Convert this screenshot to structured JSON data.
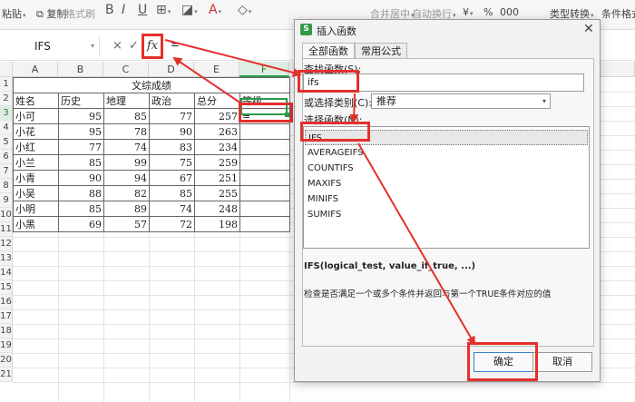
{
  "ribbon": {
    "items": [
      {
        "label": "粘贴",
        "dim": false
      },
      {
        "label": "复制",
        "dim": false
      },
      {
        "label": "格式刷",
        "dim": true
      },
      {
        "label": "B",
        "dim": false
      },
      {
        "label": "I",
        "dim": false
      },
      {
        "label": "U",
        "dim": false
      },
      {
        "label": "合并居中",
        "dim": true
      },
      {
        "label": "自动换行",
        "dim": true
      },
      {
        "label": "¥",
        "dim": false
      },
      {
        "label": "%",
        "dim": false
      },
      {
        "label": "000",
        "dim": false
      },
      {
        "label": "类型转换",
        "dim": false
      },
      {
        "label": "条件格式",
        "dim": false
      }
    ]
  },
  "formula_bar": {
    "name_box": "IFS",
    "cancel_icon": "×",
    "confirm_icon": "✓",
    "fx_label": "fx",
    "content": "="
  },
  "sheet": {
    "columns": [
      "A",
      "B",
      "C",
      "D",
      "E",
      "F"
    ],
    "selected_column": "F",
    "row_numbers": [
      "1",
      "2",
      "3",
      "4",
      "5",
      "6",
      "7",
      "8",
      "9",
      "10",
      "11",
      "12",
      "13",
      "14",
      "15",
      "16",
      "17",
      "18",
      "19",
      "20",
      "21"
    ],
    "title": "文综成绩",
    "headers": [
      "姓名",
      "历史",
      "地理",
      "政治",
      "总分",
      "等级"
    ],
    "rows": [
      [
        "小可",
        "95",
        "85",
        "77",
        "257",
        "="
      ],
      [
        "小花",
        "95",
        "78",
        "90",
        "263",
        ""
      ],
      [
        "小红",
        "77",
        "74",
        "83",
        "234",
        ""
      ],
      [
        "小兰",
        "85",
        "99",
        "75",
        "259",
        ""
      ],
      [
        "小青",
        "90",
        "94",
        "67",
        "251",
        ""
      ],
      [
        "小吴",
        "88",
        "82",
        "85",
        "255",
        ""
      ],
      [
        "小明",
        "85",
        "89",
        "74",
        "248",
        ""
      ],
      [
        "小黑",
        "69",
        "57",
        "72",
        "198",
        ""
      ]
    ]
  },
  "dialog": {
    "title": "插入函数",
    "tabs": [
      "全部函数",
      "常用公式"
    ],
    "search_label": "查找函数(S):",
    "search_value": "ifs",
    "category_label": "或选择类别(C):",
    "category_value": "推荐",
    "list_label": "选择函数(N):",
    "functions": [
      "IFS",
      "AVERAGEIFS",
      "COUNTIFS",
      "MAXIFS",
      "MINIFS",
      "SUMIFS"
    ],
    "selected_function": "IFS",
    "syntax": "IFS(logical_test, value_if_true, ...)",
    "description": "检查是否满足一个或多个条件并返回与第一个TRUE条件对应的值",
    "ok_label": "确定",
    "cancel_label": "取消"
  },
  "colors": {
    "highlight": "#e4302c",
    "selection": "#2a9a4a",
    "primary_button_border": "#3b7fd3"
  }
}
